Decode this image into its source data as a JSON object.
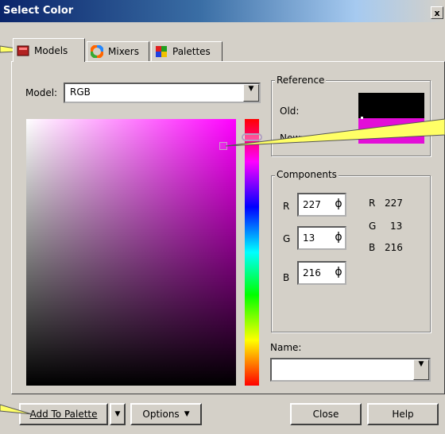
{
  "window": {
    "title": "Select Color",
    "close_glyph": "x"
  },
  "tabs": [
    {
      "label": "Models",
      "icon": "models-icon",
      "active": true
    },
    {
      "label": "Mixers",
      "icon": "mixers-icon",
      "active": false
    },
    {
      "label": "Palettes",
      "icon": "palettes-icon",
      "active": false
    }
  ],
  "model": {
    "label": "Model:",
    "value": "RGB"
  },
  "reference": {
    "title": "Reference",
    "old_label": "Old:",
    "new_label": "New:",
    "old_color": "#000000",
    "new_color": "#e30dd8"
  },
  "components": {
    "title": "Components",
    "inputs": [
      {
        "label": "R",
        "value": "227"
      },
      {
        "label": "G",
        "value": "13"
      },
      {
        "label": "B",
        "value": "216"
      }
    ],
    "readout": [
      {
        "label": "R",
        "value": "227"
      },
      {
        "label": "G",
        "value": "13"
      },
      {
        "label": "B",
        "value": "216"
      }
    ]
  },
  "name": {
    "label": "Name:",
    "value": ""
  },
  "buttons": {
    "add_to_palette": "Add To Palette",
    "options": "Options",
    "close": "Close",
    "help": "Help"
  },
  "colors": {
    "selected": "#e30dd8",
    "title_bar": "#0a246a",
    "dialog_face": "#d4d0c8",
    "callout_fill": "#ffff66"
  }
}
